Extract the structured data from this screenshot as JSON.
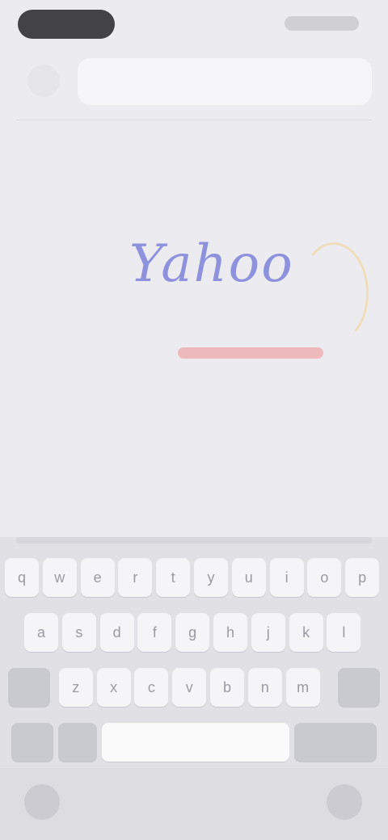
{
  "status_bar": {
    "time": "",
    "indicators": ""
  },
  "search": {
    "query": ""
  },
  "logo": {
    "word": "Yahoo"
  },
  "keyboard": {
    "row1": [
      "q",
      "w",
      "e",
      "r",
      "t",
      "y",
      "u",
      "i",
      "o",
      "p"
    ],
    "row2": [
      "a",
      "s",
      "d",
      "f",
      "g",
      "h",
      "j",
      "k",
      "l"
    ],
    "row3": [
      "z",
      "x",
      "c",
      "v",
      "b",
      "n",
      "m"
    ],
    "space_label": "",
    "return_label": ""
  }
}
